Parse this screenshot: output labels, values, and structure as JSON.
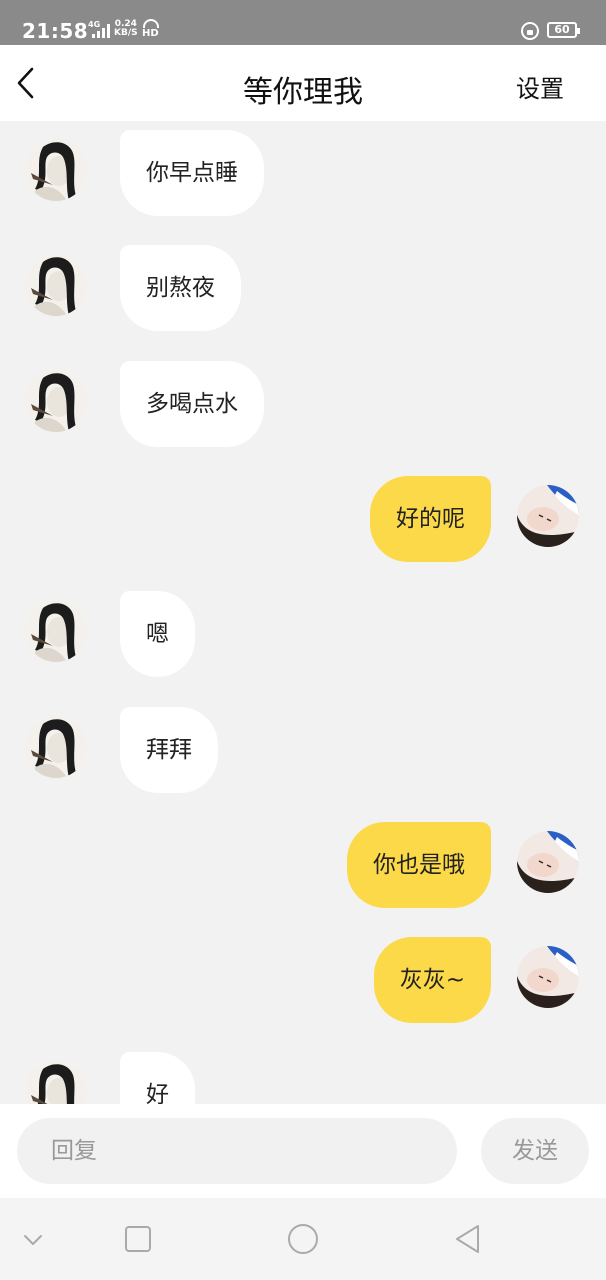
{
  "status_bar": {
    "time": "21:58",
    "network_type": "4G",
    "speed_value": "0.24",
    "speed_unit": "KB/S",
    "hd": "HD",
    "battery": "60",
    "icons": [
      "signal-icon",
      "hd-icon",
      "orientation-lock-icon",
      "battery-icon"
    ]
  },
  "header": {
    "title": "等你理我",
    "back_icon": "chevron-left-icon",
    "settings_label": "设置"
  },
  "messages": [
    {
      "side": "left",
      "text": "你早点睡"
    },
    {
      "side": "left",
      "text": "别熬夜"
    },
    {
      "side": "left",
      "text": "多喝点水"
    },
    {
      "side": "right",
      "text": "好的呢"
    },
    {
      "side": "left",
      "text": "嗯"
    },
    {
      "side": "left",
      "text": "拜拜"
    },
    {
      "side": "right",
      "text": "你也是哦"
    },
    {
      "side": "right",
      "text": "灰灰~"
    },
    {
      "side": "left",
      "text": "好"
    }
  ],
  "input_bar": {
    "placeholder": "回复",
    "value": "",
    "send_label": "发送"
  },
  "nav_bar": {
    "icons": [
      "chevron-down-icon",
      "square-icon",
      "circle-icon",
      "triangle-back-icon"
    ]
  },
  "colors": {
    "my_bubble": "#fbd948",
    "their_bubble": "#ffffff",
    "background": "#f2f2f2"
  }
}
